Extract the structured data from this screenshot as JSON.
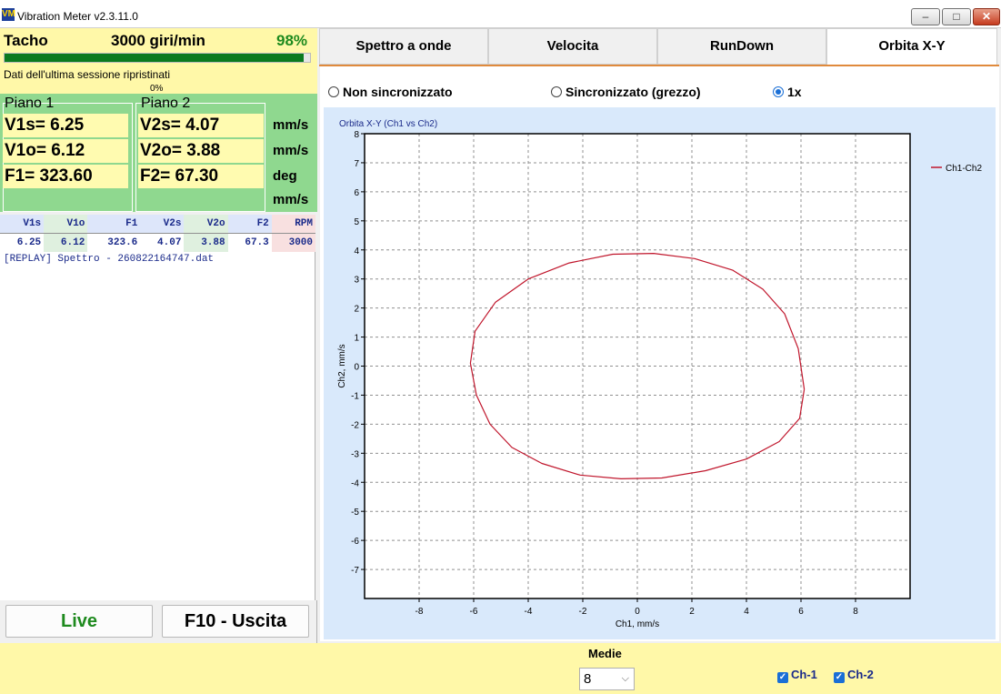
{
  "window": {
    "app_icon_text": "VM",
    "title": "Vibration Meter v2.3.11.0",
    "minimize_glyph": "–",
    "maximize_glyph": "□",
    "close_glyph": "✕"
  },
  "tacho": {
    "label": "Tacho",
    "value": "3000 giri/min",
    "percent_label": "98%",
    "progress": 0.98,
    "status": "Dati dell'ultima sessione ripristinati",
    "sub_percent": "0%"
  },
  "planes": {
    "plane1_label": "Piano 1",
    "plane2_label": "Piano 2",
    "v1s": "V1s= 6.25",
    "v1o": "V1o= 6.12",
    "f1": "F1= 323.60",
    "v2s": "V2s= 4.07",
    "v2o": "V2o= 3.88",
    "f2": "F2= 67.30",
    "units": [
      "mm/s",
      "mm/s",
      "deg",
      "mm/s"
    ]
  },
  "table": {
    "headers": [
      "V1s",
      "V1o",
      "F1",
      "V2s",
      "V2o",
      "F2",
      "RPM"
    ],
    "row": [
      "6.25",
      "6.12",
      "323.6",
      "4.07",
      "3.88",
      "67.3",
      "3000"
    ]
  },
  "log": [
    "[REPLAY] Spettro - 260822164747.dat"
  ],
  "buttons": {
    "live": "Live",
    "exit": "F10 - Uscita"
  },
  "tabs": [
    "Spettro a onde",
    "Velocita",
    "RunDown",
    "Orbita X-Y"
  ],
  "active_tab": "Orbita X-Y",
  "radios": [
    {
      "label": "Non sincronizzato",
      "selected": false
    },
    {
      "label": "Sincronizzato (grezzo)",
      "selected": false
    },
    {
      "label": "1x",
      "selected": true
    }
  ],
  "chart_data": {
    "type": "line",
    "title": "Orbita X-Y (Ch1 vs Ch2)",
    "xlabel": "Ch1, mm/s",
    "ylabel": "Ch2, mm/s",
    "xlim": [
      -10,
      10
    ],
    "ylim": [
      -8,
      8
    ],
    "xticks": [
      -8,
      -6,
      -4,
      -2,
      0,
      2,
      4,
      6,
      8
    ],
    "yticks": [
      8,
      7,
      6,
      5,
      4,
      3,
      2,
      1,
      0,
      -1,
      -2,
      -3,
      -4,
      -5,
      -6,
      -7
    ],
    "grid": true,
    "legend_position": "top-right",
    "series": [
      {
        "name": "Ch1-Ch2",
        "color": "#c0162c",
        "x": [
          6.12,
          5.95,
          5.2,
          4.0,
          2.5,
          0.9,
          -0.6,
          -2.1,
          -3.5,
          -4.6,
          -5.4,
          -5.9,
          -6.12,
          -5.95,
          -5.2,
          -4.0,
          -2.5,
          -0.9,
          0.6,
          2.1,
          3.5,
          4.6,
          5.4,
          5.9,
          6.12
        ],
        "y": [
          -0.8,
          -1.8,
          -2.6,
          -3.2,
          -3.6,
          -3.85,
          -3.88,
          -3.75,
          -3.35,
          -2.8,
          -2.0,
          -1.0,
          0.1,
          1.2,
          2.2,
          3.0,
          3.55,
          3.85,
          3.88,
          3.7,
          3.3,
          2.65,
          1.8,
          0.6,
          -0.8
        ]
      }
    ]
  },
  "footer": {
    "medie_label": "Medie",
    "medie_value": "8",
    "ch1_label": "Ch-1",
    "ch2_label": "Ch-2",
    "ch1_checked": true,
    "ch2_checked": true
  }
}
